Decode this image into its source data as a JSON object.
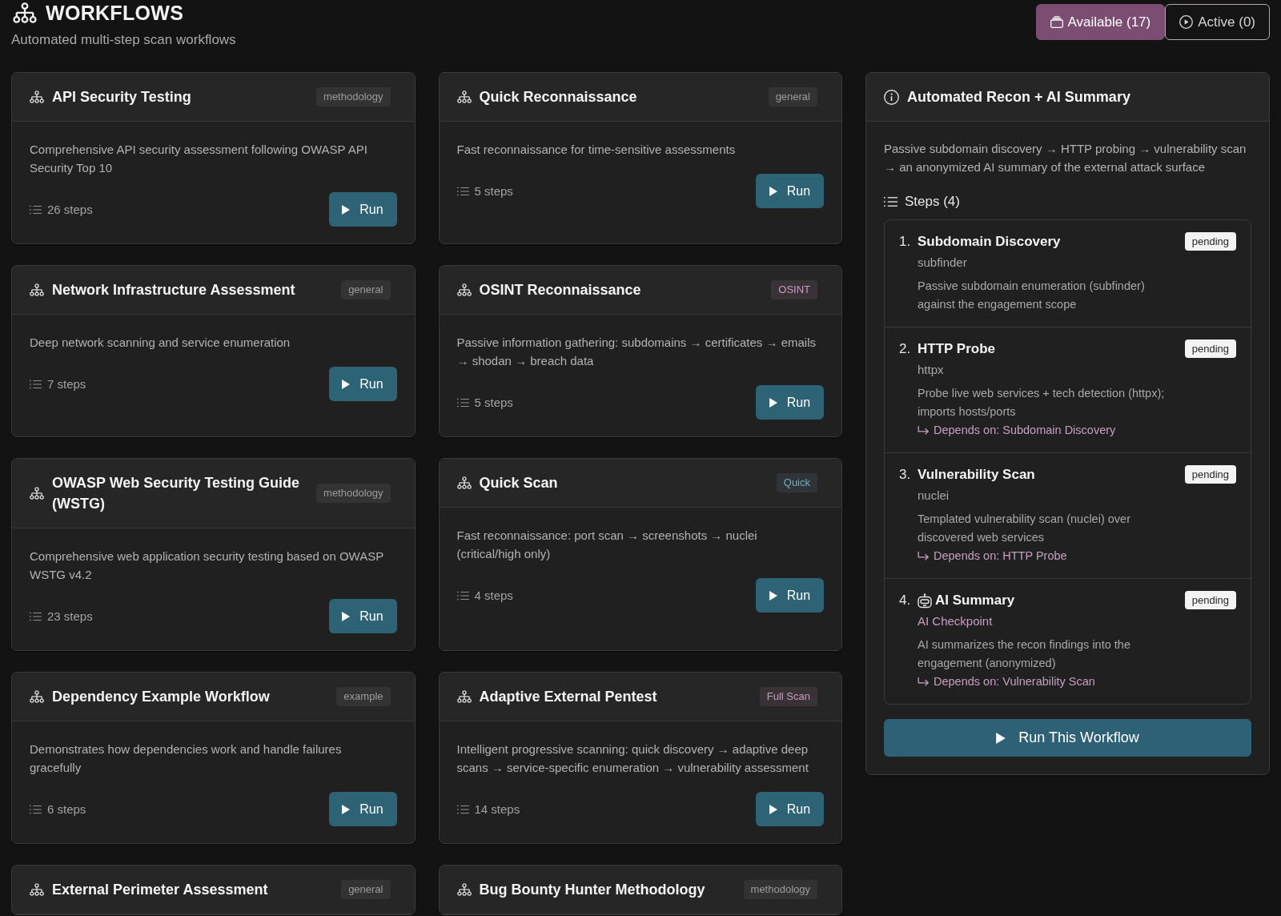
{
  "header": {
    "title": "WORKFLOWS",
    "subtitle": "Automated multi-step scan workflows"
  },
  "tabs": [
    {
      "label": "Available (17)",
      "kind": "available",
      "selected": true
    },
    {
      "label": "Active (0)",
      "kind": "active",
      "selected": false
    }
  ],
  "workflows": [
    {
      "title": "API Security Testing",
      "tag": {
        "label": "methodology",
        "color": "#9c9c9c"
      },
      "description": "Comprehensive API security assessment following OWASP API Security Top 10",
      "steps": "26 steps",
      "run_label": "Run"
    },
    {
      "title": "Quick Reconnaissance",
      "tag": {
        "label": "general",
        "color": "#9c9c9c"
      },
      "description": "Fast reconnaissance for time-sensitive assessments",
      "steps": "5 steps",
      "run_label": "Run"
    },
    {
      "title": "Network Infrastructure Assessment",
      "tag": {
        "label": "general",
        "color": "#9c9c9c"
      },
      "description": "Deep network scanning and service enumeration",
      "steps": "7 steps",
      "run_label": "Run"
    },
    {
      "title": "OSINT Reconnaissance",
      "tag": {
        "label": "OSINT",
        "color": "#c99cc0"
      },
      "description": "Passive information gathering: subdomains → certificates → emails → shodan → breach data",
      "steps": "5 steps",
      "run_label": "Run"
    },
    {
      "title": "OWASP Web Security Testing Guide (WSTG)",
      "tag": {
        "label": "methodology",
        "color": "#9c9c9c"
      },
      "description": "Comprehensive web application security testing based on OWASP WSTG v4.2",
      "steps": "23 steps",
      "run_label": "Run"
    },
    {
      "title": "Quick Scan",
      "tag": {
        "label": "Quick",
        "color": "#7aa9bb"
      },
      "description": "Fast reconnaissance: port scan → screenshots → nuclei (critical/high only)",
      "steps": "4 steps",
      "run_label": "Run"
    },
    {
      "title": "Dependency Example Workflow",
      "tag": {
        "label": "example",
        "color": "#9c9c9c"
      },
      "description": "Demonstrates how dependencies work and handle failures gracefully",
      "steps": "6 steps",
      "run_label": "Run"
    },
    {
      "title": "Adaptive External Pentest",
      "tag": {
        "label": "Full Scan",
        "color": "#c99cc0"
      },
      "description": "Intelligent progressive scanning: quick discovery → adaptive deep scans → service-specific enumeration → vulnerability assessment",
      "steps": "14 steps",
      "run_label": "Run"
    },
    {
      "title": "External Perimeter Assessment",
      "tag": {
        "label": "general",
        "color": "#9c9c9c"
      }
    },
    {
      "title": "Bug Bounty Hunter Methodology",
      "tag": {
        "label": "methodology",
        "color": "#9c9c9c"
      }
    }
  ],
  "detail": {
    "title": "Automated Recon + AI Summary",
    "description": "Passive subdomain discovery → HTTP probing → vulnerability scan → an anonymized AI summary of the external attack surface",
    "steps_heading": "Steps (4)",
    "steps": [
      {
        "number": "1.",
        "title": "Subdomain Discovery",
        "kind": "tool",
        "tool": "subfinder",
        "status": "pending",
        "description": "Passive subdomain enumeration (subfinder) against the engagement scope"
      },
      {
        "number": "2.",
        "title": "HTTP Probe",
        "kind": "tool",
        "tool": "httpx",
        "status": "pending",
        "description": "Probe live web services + tech detection (httpx); imports hosts/ports",
        "depends_on": "Depends on: Subdomain Discovery"
      },
      {
        "number": "3.",
        "title": "Vulnerability Scan",
        "kind": "tool",
        "tool": "nuclei",
        "status": "pending",
        "description": "Templated vulnerability scan (nuclei) over discovered web services",
        "depends_on": "Depends on: HTTP Probe"
      },
      {
        "number": "4.",
        "title": "AI Summary",
        "kind": "ai",
        "tool": "AI Checkpoint",
        "status": "pending",
        "description": "AI summarizes the recon findings into the engagement (anonymized)",
        "depends_on": "Depends on: Vulnerability Scan"
      }
    ],
    "run_label": "Run This Workflow"
  }
}
